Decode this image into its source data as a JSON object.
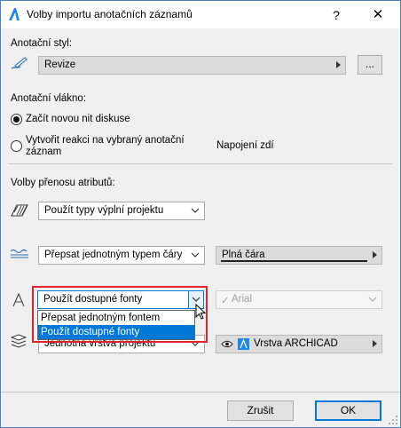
{
  "window": {
    "title": "Volby importu anotačních záznamů",
    "help_glyph": "?",
    "close_glyph": "✕"
  },
  "annotation_style": {
    "label": "Anotační styl:",
    "value": "Revize",
    "browse_label": "..."
  },
  "annotation_thread": {
    "label": "Anotační vlákno:",
    "option_new": "Začít novou nit diskuse",
    "option_reply": "Vytvořit reakci na vybraný anotační záznam",
    "selected": "option_new",
    "target": "Napojení zdí"
  },
  "transfer": {
    "label": "Volby přenosu atributů:",
    "fill": {
      "value": "Použít typy výplní projektu"
    },
    "line": {
      "value": "Přepsat jednotným typem čáry",
      "line_type": "Plná čára"
    },
    "font": {
      "value": "Použít dostupné fonty",
      "font_name": "Arial",
      "font_check": "✓",
      "options": [
        "Přepsat jednotným fontem",
        "Použít dostupné fonty"
      ],
      "selected_option_index": 1
    },
    "layer": {
      "value": "Jednotná vrstva projektu",
      "layer_name": "Vrstva ARCHICAD"
    }
  },
  "footer": {
    "cancel_label": "Zrušit",
    "ok_label": "OK"
  },
  "colors": {
    "accent": "#0078d7",
    "highlight": "#e0242b",
    "title_icon": "#1e88e5"
  }
}
